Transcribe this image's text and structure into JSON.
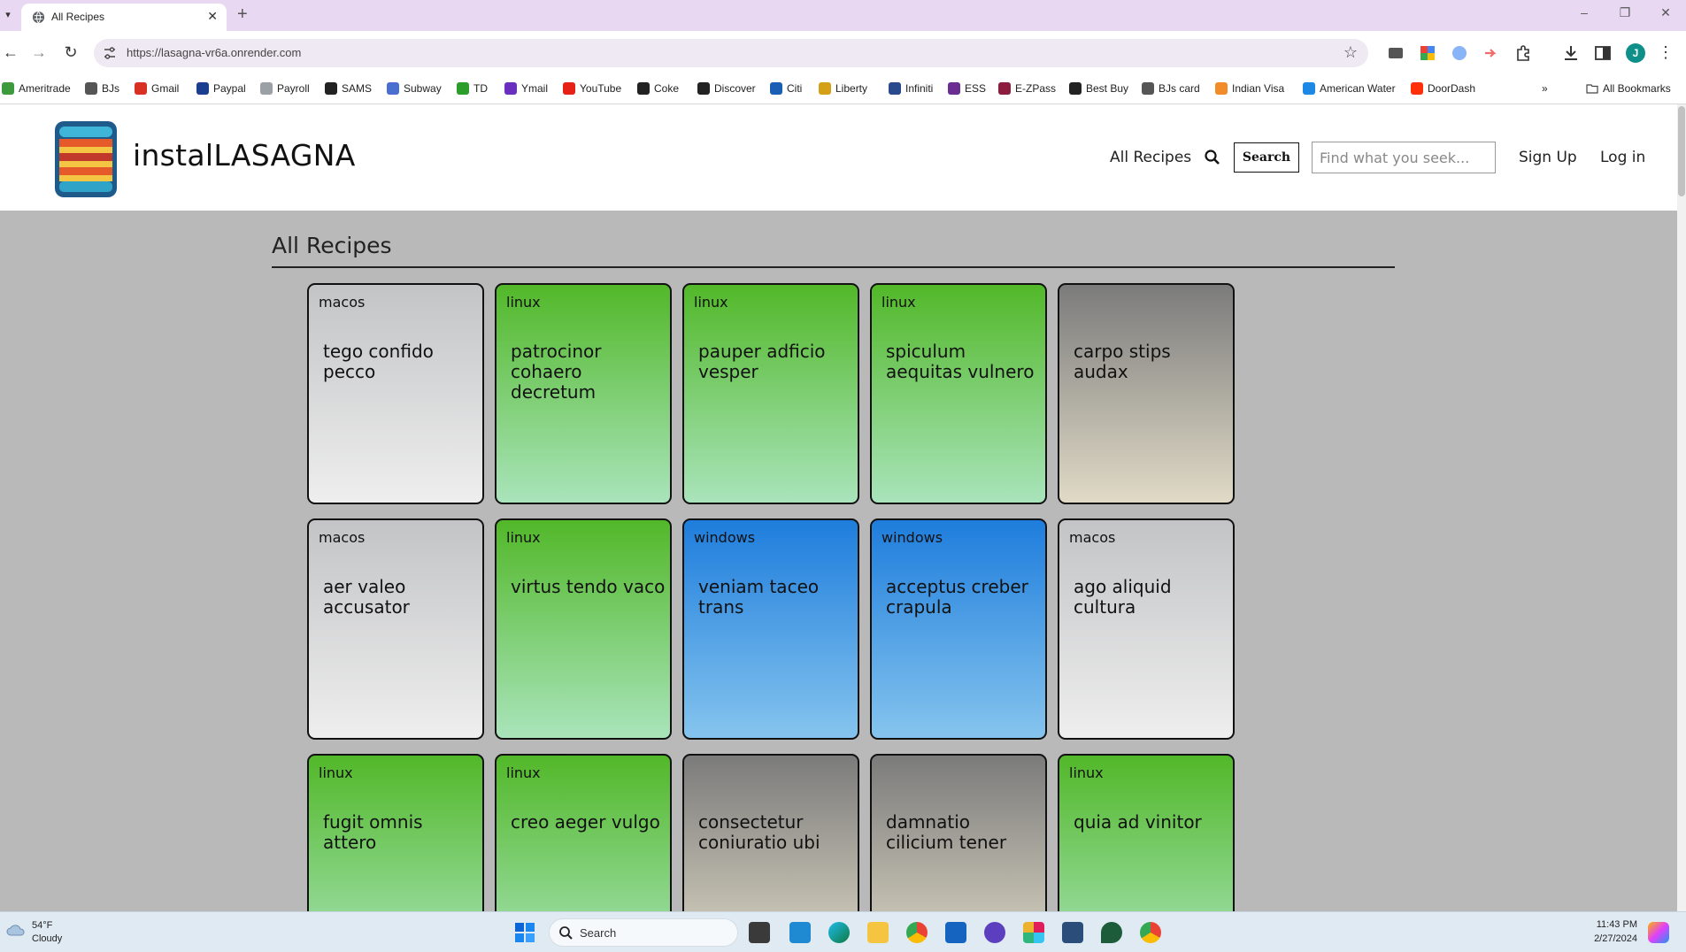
{
  "browser": {
    "tab_title": "All Recipes",
    "url": "https://lasagna-vr6a.onrender.com",
    "profile_initial": "J",
    "bookmarks": [
      {
        "label": "Ameritrade",
        "color": "#3d9a3d"
      },
      {
        "label": "BJs",
        "color": "#555555"
      },
      {
        "label": "Gmail",
        "color": "#d93025"
      },
      {
        "label": "Paypal",
        "color": "#1b3e8f"
      },
      {
        "label": "Payroll",
        "color": "#9aa0a6"
      },
      {
        "label": "SAMS",
        "color": "#222222"
      },
      {
        "label": "Subway",
        "color": "#4a6fd1"
      },
      {
        "label": "TD",
        "color": "#2a9d2a"
      },
      {
        "label": "Ymail",
        "color": "#6b2fbf"
      },
      {
        "label": "YouTube",
        "color": "#e62117"
      },
      {
        "label": "Coke",
        "color": "#222222"
      },
      {
        "label": "Discover",
        "color": "#222222"
      },
      {
        "label": "Citi",
        "color": "#1a5fb4"
      },
      {
        "label": "Liberty",
        "color": "#d4a017"
      },
      {
        "label": "Infiniti",
        "color": "#2b4a8b"
      },
      {
        "label": "ESS",
        "color": "#6a2d91"
      },
      {
        "label": "E-ZPass",
        "color": "#8b1e3f"
      },
      {
        "label": "Best Buy",
        "color": "#222222"
      },
      {
        "label": "BJs card",
        "color": "#555555"
      },
      {
        "label": "Indian Visa",
        "color": "#f28c28"
      },
      {
        "label": "American Water",
        "color": "#1e88e5"
      },
      {
        "label": "DoorDash",
        "color": "#ff3008"
      }
    ],
    "all_bookmarks_label": "All Bookmarks"
  },
  "site": {
    "brand": "instalLASAGNA",
    "nav_all_recipes": "All Recipes",
    "search_button": "Search",
    "search_placeholder": "Find what you seek...",
    "sign_up": "Sign Up",
    "log_in": "Log in"
  },
  "page": {
    "title": "All Recipes",
    "recipes": [
      {
        "os": "macos",
        "name": "tego confido pecco",
        "theme": "macos"
      },
      {
        "os": "linux",
        "name": "patrocinor cohaero decretum",
        "theme": "linux"
      },
      {
        "os": "linux",
        "name": "pauper adficio vesper",
        "theme": "linux"
      },
      {
        "os": "linux",
        "name": "spiculum aequitas vulnero",
        "theme": "linux"
      },
      {
        "os": "",
        "name": "carpo stips audax",
        "theme": "other"
      },
      {
        "os": "macos",
        "name": "aer valeo accusator",
        "theme": "macos"
      },
      {
        "os": "linux",
        "name": "virtus tendo vaco",
        "theme": "linux"
      },
      {
        "os": "windows",
        "name": "veniam taceo trans",
        "theme": "windows"
      },
      {
        "os": "windows",
        "name": "acceptus creber crapula",
        "theme": "windows"
      },
      {
        "os": "macos",
        "name": "ago aliquid cultura",
        "theme": "macos"
      },
      {
        "os": "linux",
        "name": "fugit omnis attero",
        "theme": "linux"
      },
      {
        "os": "linux",
        "name": "creo aeger vulgo",
        "theme": "linux"
      },
      {
        "os": "",
        "name": "consectetur coniuratio ubi",
        "theme": "other"
      },
      {
        "os": "",
        "name": "damnatio cilicium tener",
        "theme": "other"
      },
      {
        "os": "linux",
        "name": "quia ad vinitor",
        "theme": "linux"
      }
    ]
  },
  "taskbar": {
    "weather_temp": "54°F",
    "weather_condition": "Cloudy",
    "search_label": "Search",
    "time": "11:43 PM",
    "date": "2/27/2024"
  }
}
